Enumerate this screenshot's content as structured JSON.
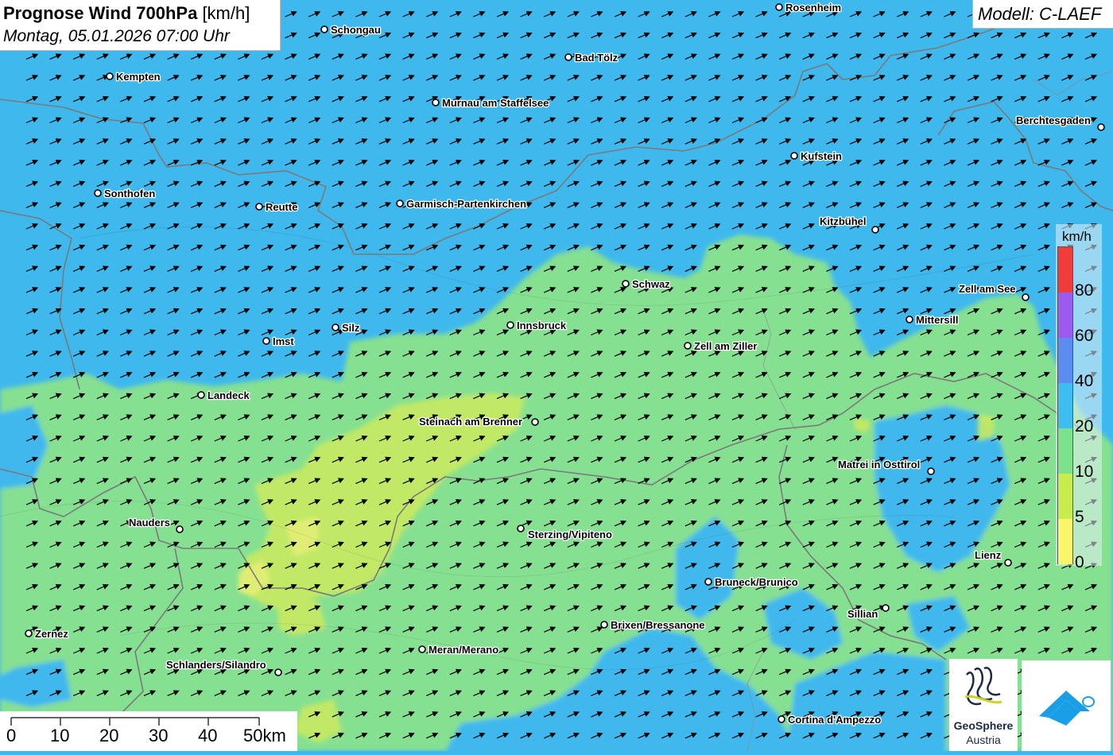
{
  "title": {
    "main": "Prognose Wind 700hPa",
    "unit": "[km/h]",
    "date": "Montag, 05.01.2026 07:00 Uhr"
  },
  "model_label": "Modell: C-LAEF",
  "legend": {
    "unit": "km/h",
    "classes": [
      {
        "label": "80",
        "color": "#f23c3c"
      },
      {
        "label": "60",
        "color": "#9b5bee"
      },
      {
        "label": "40",
        "color": "#5b8cf0"
      },
      {
        "label": "20",
        "color": "#3dbdf0"
      },
      {
        "label": "10",
        "color": "#7ce38c"
      },
      {
        "label": "5",
        "color": "#c8ec4c"
      },
      {
        "label": "0",
        "color": "#fbf56c"
      }
    ],
    "top_color": "#f23c3c"
  },
  "scale_bar": {
    "labels": [
      "0",
      "10",
      "20",
      "30",
      "40",
      "50km"
    ]
  },
  "wind": {
    "direction": "from WSW",
    "arrow_color": "#000000"
  },
  "cities": [
    {
      "name": "Rosenheim"
    },
    {
      "name": "Schongau"
    },
    {
      "name": "Bad Tölz"
    },
    {
      "name": "Kempten"
    },
    {
      "name": "Murnau am Staffelsee"
    },
    {
      "name": "Berchtesgaden"
    },
    {
      "name": "Kufstein"
    },
    {
      "name": "Sonthofen"
    },
    {
      "name": "Reutte"
    },
    {
      "name": "Garmisch-Partenkirchen"
    },
    {
      "name": "Kitzbühel"
    },
    {
      "name": "Schwaz"
    },
    {
      "name": "Zell am See"
    },
    {
      "name": "Mittersill"
    },
    {
      "name": "Innsbruck"
    },
    {
      "name": "Silz"
    },
    {
      "name": "Imst"
    },
    {
      "name": "Zell am Ziller"
    },
    {
      "name": "Landeck"
    },
    {
      "name": "Steinach am Brenner"
    },
    {
      "name": "Matrei in Osttirol"
    },
    {
      "name": "Nauders"
    },
    {
      "name": "Sterzing/Vipiteno"
    },
    {
      "name": "Lienz"
    },
    {
      "name": "Bruneck/Brunico"
    },
    {
      "name": "Sillian"
    },
    {
      "name": "Brixen/Bressanone"
    },
    {
      "name": "Zernez"
    },
    {
      "name": "Meran/Merano"
    },
    {
      "name": "Schlanders/Silandro"
    },
    {
      "name": "Cortina d'Ampezzo"
    }
  ],
  "logos": {
    "geosphere_name": "GeoSphere",
    "geosphere_sub": "Austria"
  }
}
